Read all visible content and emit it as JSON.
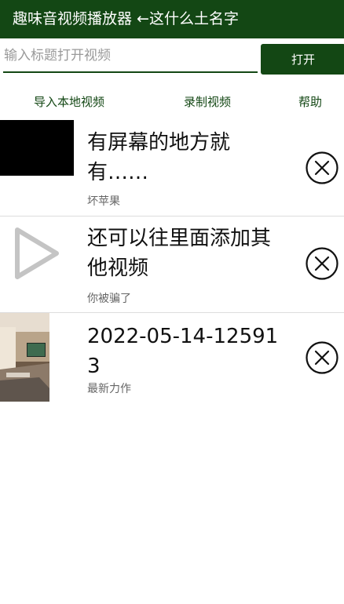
{
  "header": {
    "title": "趣味音视频播放器 ←这什么土名字"
  },
  "search": {
    "placeholder": "输入标题打开视频",
    "value": "",
    "open_label": "打开"
  },
  "actions": [
    {
      "label": "导入本地视频"
    },
    {
      "label": "录制视频"
    },
    {
      "label": "帮助"
    }
  ],
  "videos": [
    {
      "title": "有屏幕的地方就有……",
      "subtitle": "坏苹果",
      "thumbnail": "black-screen"
    },
    {
      "title": "还可以往里面添加其他视频",
      "subtitle": "你被骗了",
      "thumbnail": "play-icon"
    },
    {
      "title": "2022-05-14-125913",
      "subtitle": "最新力作",
      "thumbnail": "room-photo"
    }
  ],
  "icons": {
    "delete": "close-circle-icon",
    "play": "play-icon"
  },
  "colors": {
    "brand": "#134714",
    "subtitle": "#666666",
    "divider": "#dddddd"
  }
}
